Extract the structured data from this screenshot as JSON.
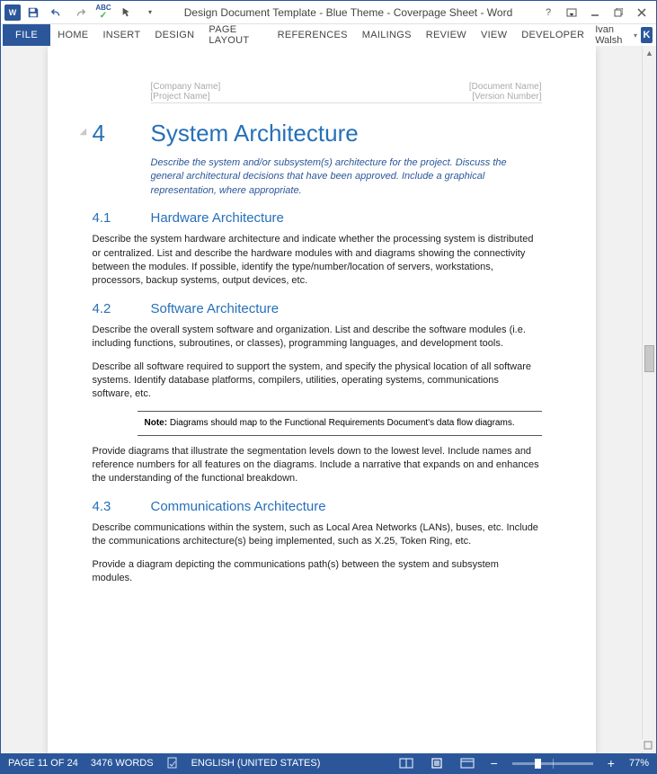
{
  "titlebar": {
    "title": "Design Document Template - Blue Theme - Coverpage Sheet - Word"
  },
  "ribbon": {
    "file": "FILE",
    "tabs": [
      "HOME",
      "INSERT",
      "DESIGN",
      "PAGE LAYOUT",
      "REFERENCES",
      "MAILINGS",
      "REVIEW",
      "VIEW",
      "DEVELOPER"
    ],
    "user": "Ivan Walsh",
    "user_initial": "K"
  },
  "doc": {
    "header_left1": "[Company Name]",
    "header_right1": "[Document Name]",
    "header_left2": "[Project Name]",
    "header_right2": "[Version Number]",
    "h1_num": "4",
    "h1_title": "System Architecture",
    "instr": "Describe the system and/or subsystem(s) architecture for the project. Discuss the general architectural decisions that have been approved. Include a graphical representation, where appropriate.",
    "s1_num": "4.1",
    "s1_title": "Hardware Architecture",
    "s1_p1": "Describe the system hardware architecture and indicate whether the processing system is distributed or centralized. List and describe the hardware modules with and diagrams showing the connectivity between the modules. If possible, identify the type/number/location of servers, workstations, processors, backup systems, output devices, etc.",
    "s2_num": "4.2",
    "s2_title": "Software Architecture",
    "s2_p1": "Describe the overall system software and organization. List and describe the software modules (i.e. including functions, subroutines, or classes), programming languages, and development tools.",
    "s2_p2": "Describe all software required to support the system, and specify the physical location of all software systems. Identify database platforms, compilers, utilities, operating systems, communications software, etc.",
    "note_label": "Note:",
    "note_body": " Diagrams should map to the Functional Requirements Document's data flow diagrams.",
    "s2_p3": "Provide diagrams that illustrate the segmentation levels down to the lowest level. Include names and reference numbers for all features on the diagrams. Include a narrative that expands on and enhances the understanding of the functional breakdown.",
    "s3_num": "4.3",
    "s3_title": "Communications Architecture",
    "s3_p1": "Describe communications within the system, such as Local Area Networks (LANs), buses, etc. Include the communications architecture(s) being implemented, such as X.25, Token Ring, etc.",
    "s3_p2": "Provide a diagram depicting the communications path(s) between the system and subsystem modules."
  },
  "status": {
    "page": "PAGE 11 OF 24",
    "words": "3476 WORDS",
    "lang": "ENGLISH (UNITED STATES)",
    "zoom": "77%"
  }
}
